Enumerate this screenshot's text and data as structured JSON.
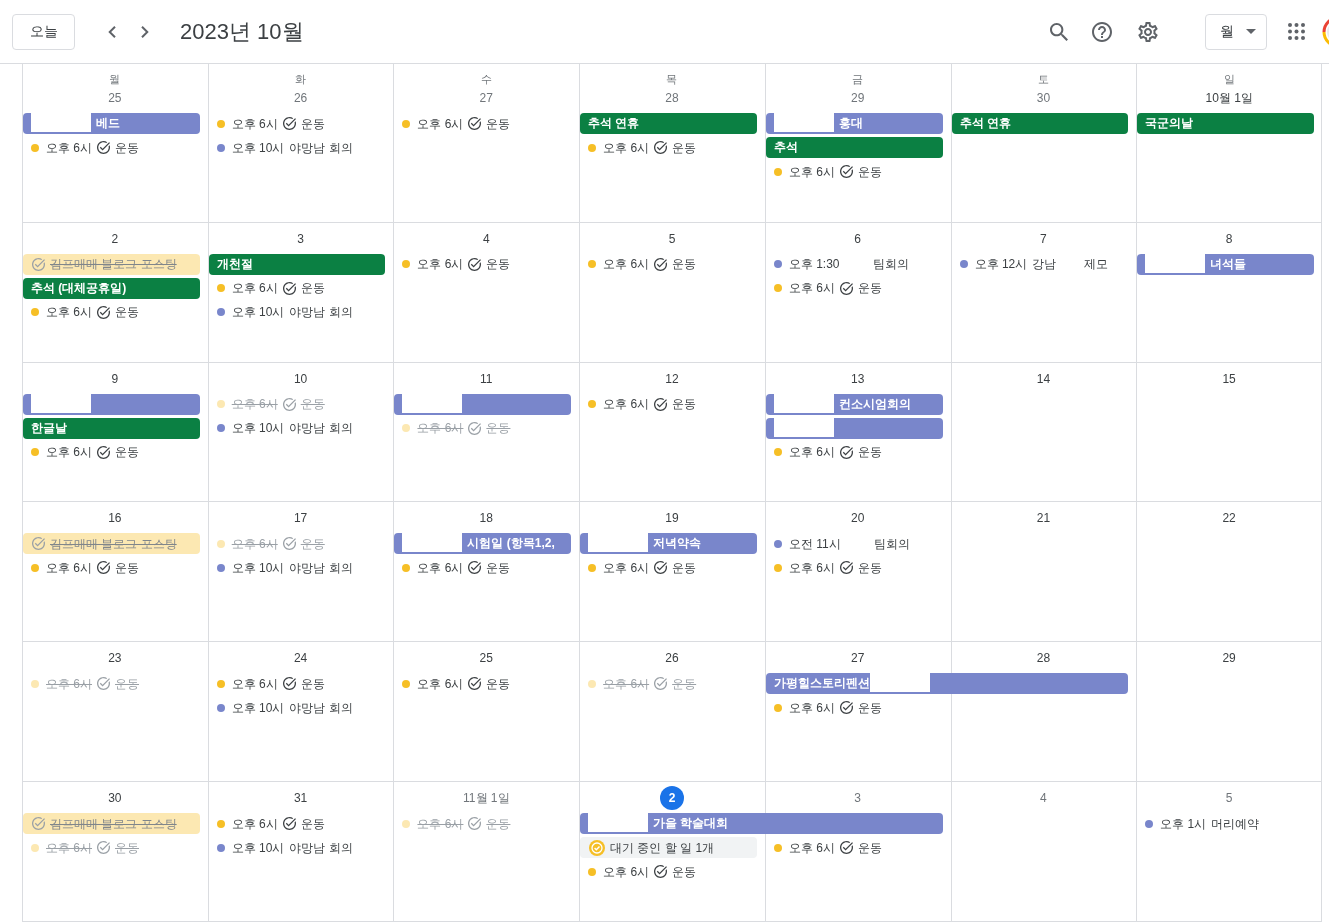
{
  "toolbar": {
    "today_button": "오늘",
    "title": "2023년 10월",
    "view_button": "월"
  },
  "weekdays": [
    "월",
    "화",
    "수",
    "목",
    "금",
    "토",
    "일"
  ],
  "weeks": [
    {
      "days": [
        {
          "date": "25",
          "in_month": false,
          "today": false,
          "events": [
            {
              "kind": "chip",
              "color": "#7986cb",
              "continues_next_day": false,
              "segments": [
                {
                  "kind": "blank"
                },
                {
                  "kind": "text",
                  "text": "베드"
                }
              ]
            },
            {
              "kind": "task",
              "color": "#f6bf26",
              "time": "오후 6시",
              "title": "운동",
              "done": false
            }
          ]
        },
        {
          "date": "26",
          "in_month": false,
          "today": false,
          "events": [
            {
              "kind": "task",
              "color": "#f6bf26",
              "time": "오후 6시",
              "title": "운동",
              "done": false
            },
            {
              "kind": "event",
              "color": "#7986cb",
              "time": "오후 10시",
              "segments": [
                {
                  "kind": "text",
                  "text": "야망남 회의"
                }
              ]
            }
          ]
        },
        {
          "date": "27",
          "in_month": false,
          "today": false,
          "events": [
            {
              "kind": "task",
              "color": "#f6bf26",
              "time": "오후 6시",
              "title": "운동",
              "done": false
            }
          ]
        },
        {
          "date": "28",
          "in_month": false,
          "today": false,
          "events": [
            {
              "kind": "chip",
              "color": "#0b8043",
              "continues_next_day": false,
              "segments": [
                {
                  "kind": "text",
                  "text": "추석 연휴"
                }
              ]
            },
            {
              "kind": "task",
              "color": "#f6bf26",
              "time": "오후 6시",
              "title": "운동",
              "done": false
            }
          ]
        },
        {
          "date": "29",
          "in_month": false,
          "today": false,
          "events": [
            {
              "kind": "chip",
              "color": "#7986cb",
              "continues_next_day": false,
              "segments": [
                {
                  "kind": "blank"
                },
                {
                  "kind": "text",
                  "text": "홍대"
                }
              ]
            },
            {
              "kind": "chip",
              "color": "#0b8043",
              "continues_next_day": false,
              "segments": [
                {
                  "kind": "text",
                  "text": "추석"
                }
              ]
            },
            {
              "kind": "task",
              "color": "#f6bf26",
              "time": "오후 6시",
              "title": "운동",
              "done": false
            }
          ]
        },
        {
          "date": "30",
          "in_month": false,
          "today": false,
          "events": [
            {
              "kind": "chip",
              "color": "#0b8043",
              "continues_next_day": false,
              "segments": [
                {
                  "kind": "text",
                  "text": "추석 연휴"
                }
              ]
            }
          ]
        },
        {
          "date": "10월 1일",
          "in_month": true,
          "today": false,
          "events": [
            {
              "kind": "chip",
              "color": "#0b8043",
              "continues_next_day": false,
              "segments": [
                {
                  "kind": "text",
                  "text": "국군의날"
                }
              ]
            }
          ]
        }
      ]
    },
    {
      "days": [
        {
          "date": "2",
          "in_month": true,
          "today": false,
          "events": [
            {
              "kind": "task_chip",
              "color": "#fce8b2",
              "title": "김프매매 블로그 포스팅",
              "done": true
            },
            {
              "kind": "chip",
              "color": "#0b8043",
              "continues_next_day": false,
              "segments": [
                {
                  "kind": "text",
                  "text": "추석 (대체공휴일)"
                }
              ]
            },
            {
              "kind": "task",
              "color": "#f6bf26",
              "time": "오후 6시",
              "title": "운동",
              "done": false
            }
          ]
        },
        {
          "date": "3",
          "in_month": true,
          "today": false,
          "events": [
            {
              "kind": "chip",
              "color": "#0b8043",
              "continues_next_day": false,
              "segments": [
                {
                  "kind": "text",
                  "text": "개천절"
                }
              ]
            },
            {
              "kind": "task",
              "color": "#f6bf26",
              "time": "오후 6시",
              "title": "운동",
              "done": false
            },
            {
              "kind": "event",
              "color": "#7986cb",
              "time": "오후 10시",
              "segments": [
                {
                  "kind": "text",
                  "text": "야망남 회의"
                }
              ]
            }
          ]
        },
        {
          "date": "4",
          "in_month": true,
          "today": false,
          "events": [
            {
              "kind": "task",
              "color": "#f6bf26",
              "time": "오후 6시",
              "title": "운동",
              "done": false
            }
          ]
        },
        {
          "date": "5",
          "in_month": true,
          "today": false,
          "events": [
            {
              "kind": "task",
              "color": "#f6bf26",
              "time": "오후 6시",
              "title": "운동",
              "done": false
            }
          ]
        },
        {
          "date": "6",
          "in_month": true,
          "today": false,
          "events": [
            {
              "kind": "event",
              "color": "#7986cb",
              "time": "오후 1:30",
              "segments": [
                {
                  "kind": "blank"
                },
                {
                  "kind": "text",
                  "text": "팀회의"
                }
              ]
            },
            {
              "kind": "task",
              "color": "#f6bf26",
              "time": "오후 6시",
              "title": "운동",
              "done": false
            }
          ]
        },
        {
          "date": "7",
          "in_month": true,
          "today": false,
          "events": [
            {
              "kind": "event",
              "color": "#7986cb",
              "time": "오후 12시",
              "segments": [
                {
                  "kind": "text",
                  "text": "강남"
                },
                {
                  "kind": "blank"
                },
                {
                  "kind": "text",
                  "text": "제모"
                }
              ]
            }
          ]
        },
        {
          "date": "8",
          "in_month": true,
          "today": false,
          "events": [
            {
              "kind": "chip",
              "color": "#7986cb",
              "continues_next_day": false,
              "segments": [
                {
                  "kind": "blank"
                },
                {
                  "kind": "text",
                  "text": "녀석들"
                }
              ]
            }
          ]
        }
      ]
    },
    {
      "days": [
        {
          "date": "9",
          "in_month": true,
          "today": false,
          "events": [
            {
              "kind": "chip",
              "color": "#7986cb",
              "continues_next_day": false,
              "segments": [
                {
                  "kind": "blank"
                }
              ]
            },
            {
              "kind": "chip",
              "color": "#0b8043",
              "continues_next_day": false,
              "segments": [
                {
                  "kind": "text",
                  "text": "한글날"
                }
              ]
            },
            {
              "kind": "task",
              "color": "#f6bf26",
              "time": "오후 6시",
              "title": "운동",
              "done": false
            }
          ]
        },
        {
          "date": "10",
          "in_month": true,
          "today": false,
          "events": [
            {
              "kind": "task",
              "color": "#fce8b2",
              "time": "오후 6시",
              "title": "운동",
              "done": true
            },
            {
              "kind": "event",
              "color": "#7986cb",
              "time": "오후 10시",
              "segments": [
                {
                  "kind": "text",
                  "text": "야망남 회의"
                }
              ]
            }
          ]
        },
        {
          "date": "11",
          "in_month": true,
          "today": false,
          "events": [
            {
              "kind": "chip",
              "color": "#7986cb",
              "continues_next_day": false,
              "segments": [
                {
                  "kind": "blank"
                }
              ]
            },
            {
              "kind": "task",
              "color": "#fce8b2",
              "time": "오후 6시",
              "title": "운동",
              "done": true
            }
          ]
        },
        {
          "date": "12",
          "in_month": true,
          "today": false,
          "events": [
            {
              "kind": "task",
              "color": "#f6bf26",
              "time": "오후 6시",
              "title": "운동",
              "done": false
            }
          ]
        },
        {
          "date": "13",
          "in_month": true,
          "today": false,
          "events": [
            {
              "kind": "chip",
              "color": "#7986cb",
              "continues_next_day": false,
              "segments": [
                {
                  "kind": "blank"
                },
                {
                  "kind": "text",
                  "text": "컨소시엄회의"
                }
              ]
            },
            {
              "kind": "chip",
              "color": "#7986cb",
              "continues_next_day": false,
              "segments": [
                {
                  "kind": "blank"
                }
              ]
            },
            {
              "kind": "task",
              "color": "#f6bf26",
              "time": "오후 6시",
              "title": "운동",
              "done": false
            }
          ]
        },
        {
          "date": "14",
          "in_month": true,
          "today": false
        },
        {
          "date": "15",
          "in_month": true,
          "today": false
        }
      ]
    },
    {
      "days": [
        {
          "date": "16",
          "in_month": true,
          "today": false,
          "events": [
            {
              "kind": "task_chip",
              "color": "#fce8b2",
              "title": "김프매매 블로그 포스팅",
              "done": true
            },
            {
              "kind": "task",
              "color": "#f6bf26",
              "time": "오후 6시",
              "title": "운동",
              "done": false
            }
          ]
        },
        {
          "date": "17",
          "in_month": true,
          "today": false,
          "events": [
            {
              "kind": "task",
              "color": "#fce8b2",
              "time": "오후 6시",
              "title": "운동",
              "done": true
            },
            {
              "kind": "event",
              "color": "#7986cb",
              "time": "오후 10시",
              "segments": [
                {
                  "kind": "text",
                  "text": "야망남 회의"
                }
              ]
            }
          ]
        },
        {
          "date": "18",
          "in_month": true,
          "today": false,
          "events": [
            {
              "kind": "chip",
              "color": "#7986cb",
              "continues_next_day": false,
              "segments": [
                {
                  "kind": "blank"
                },
                {
                  "kind": "text",
                  "text": "시험일 (항목1,2,"
                }
              ]
            },
            {
              "kind": "task",
              "color": "#f6bf26",
              "time": "오후 6시",
              "title": "운동",
              "done": false
            }
          ]
        },
        {
          "date": "19",
          "in_month": true,
          "today": false,
          "events": [
            {
              "kind": "chip",
              "color": "#7986cb",
              "continues_next_day": false,
              "segments": [
                {
                  "kind": "blank"
                },
                {
                  "kind": "text",
                  "text": "저녁약속"
                }
              ]
            },
            {
              "kind": "task",
              "color": "#f6bf26",
              "time": "오후 6시",
              "title": "운동",
              "done": false
            }
          ]
        },
        {
          "date": "20",
          "in_month": true,
          "today": false,
          "events": [
            {
              "kind": "event",
              "color": "#7986cb",
              "time": "오전 11시",
              "segments": [
                {
                  "kind": "blank"
                },
                {
                  "kind": "text",
                  "text": "팀회의"
                }
              ]
            },
            {
              "kind": "task",
              "color": "#f6bf26",
              "time": "오후 6시",
              "title": "운동",
              "done": false
            }
          ]
        },
        {
          "date": "21",
          "in_month": true,
          "today": false
        },
        {
          "date": "22",
          "in_month": true,
          "today": false
        }
      ]
    },
    {
      "days": [
        {
          "date": "23",
          "in_month": true,
          "today": false,
          "events": [
            {
              "kind": "task",
              "color": "#fce8b2",
              "time": "오후 6시",
              "title": "운동",
              "done": true
            }
          ]
        },
        {
          "date": "24",
          "in_month": true,
          "today": false,
          "events": [
            {
              "kind": "task",
              "color": "#f6bf26",
              "time": "오후 6시",
              "title": "운동",
              "done": false
            },
            {
              "kind": "event",
              "color": "#7986cb",
              "time": "오후 10시",
              "segments": [
                {
                  "kind": "text",
                  "text": "야망남 회의"
                }
              ]
            }
          ]
        },
        {
          "date": "25",
          "in_month": true,
          "today": false,
          "events": [
            {
              "kind": "task",
              "color": "#f6bf26",
              "time": "오후 6시",
              "title": "운동",
              "done": false
            }
          ]
        },
        {
          "date": "26",
          "in_month": true,
          "today": false,
          "events": [
            {
              "kind": "task",
              "color": "#fce8b2",
              "time": "오후 6시",
              "title": "운동",
              "done": true
            }
          ]
        },
        {
          "date": "27",
          "in_month": true,
          "today": false,
          "events": [
            {
              "kind": "chip",
              "color": "#7986cb",
              "continues_next_day": true,
              "segments": [
                {
                  "kind": "text",
                  "text": "가평힐스토리펜션"
                },
                {
                  "kind": "blank"
                }
              ]
            },
            {
              "kind": "task",
              "color": "#f6bf26",
              "time": "오후 6시",
              "title": "운동",
              "done": false
            }
          ]
        },
        {
          "date": "28",
          "in_month": true,
          "today": false
        },
        {
          "date": "29",
          "in_month": true,
          "today": false
        }
      ]
    },
    {
      "days": [
        {
          "date": "30",
          "in_month": true,
          "today": false,
          "events": [
            {
              "kind": "task_chip",
              "color": "#fce8b2",
              "title": "김프매매 블로그 포스팅",
              "done": true
            },
            {
              "kind": "task",
              "color": "#fce8b2",
              "time": "오후 6시",
              "title": "운동",
              "done": true
            }
          ]
        },
        {
          "date": "31",
          "in_month": true,
          "today": false,
          "events": [
            {
              "kind": "task",
              "color": "#f6bf26",
              "time": "오후 6시",
              "title": "운동",
              "done": false
            },
            {
              "kind": "event",
              "color": "#7986cb",
              "time": "오후 10시",
              "segments": [
                {
                  "kind": "text",
                  "text": "야망남 회의"
                }
              ]
            }
          ]
        },
        {
          "date": "11월 1일",
          "in_month": false,
          "today": false,
          "events": [
            {
              "kind": "task",
              "color": "#fce8b2",
              "time": "오후 6시",
              "title": "운동",
              "done": true
            }
          ]
        },
        {
          "date": "2",
          "in_month": false,
          "today": true,
          "events": [
            {
              "kind": "chip",
              "color": "#7986cb",
              "continues_next_day": true,
              "segments": [
                {
                  "kind": "blank"
                },
                {
                  "kind": "text",
                  "text": "가을 학술대회"
                }
              ]
            },
            {
              "kind": "pending",
              "title": "대기 중인 할 일 1개"
            },
            {
              "kind": "task",
              "color": "#f6bf26",
              "time": "오후 6시",
              "title": "운동",
              "done": false
            }
          ]
        },
        {
          "date": "3",
          "in_month": false,
          "today": false,
          "events": [
            {
              "kind": "task",
              "color": "#f6bf26",
              "time": "오후 6시",
              "title": "운동",
              "done": false
            }
          ]
        },
        {
          "date": "4",
          "in_month": false,
          "today": false
        },
        {
          "date": "5",
          "in_month": false,
          "today": false,
          "events": [
            {
              "kind": "event",
              "color": "#7986cb",
              "time": "오후 1시",
              "segments": [
                {
                  "kind": "text",
                  "text": "머리예약"
                }
              ]
            }
          ]
        }
      ]
    }
  ]
}
